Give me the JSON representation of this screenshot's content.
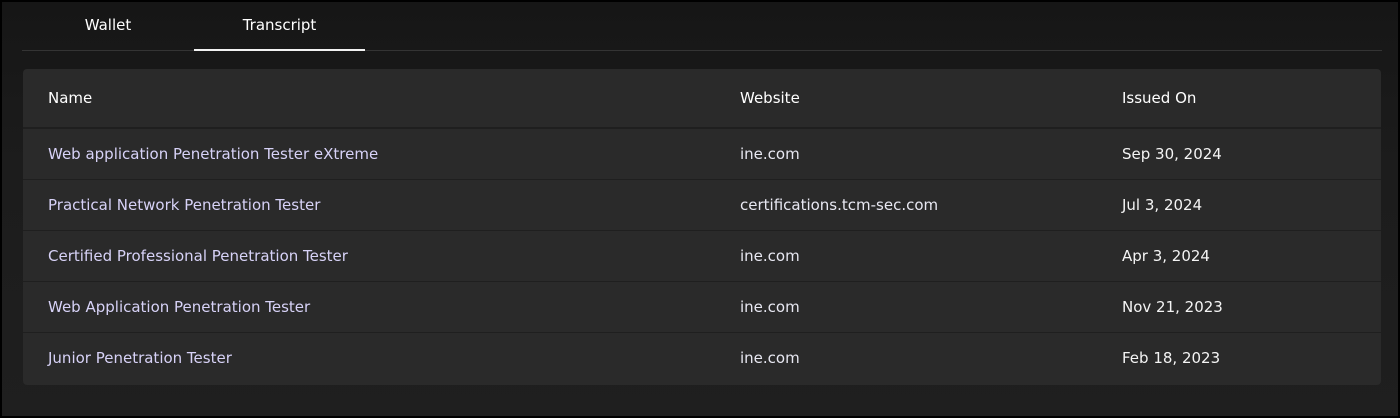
{
  "tabs": [
    {
      "label": "Wallet",
      "active": false
    },
    {
      "label": "Transcript",
      "active": true
    }
  ],
  "table": {
    "headers": [
      "Name",
      "Website",
      "Issued On"
    ],
    "rows": [
      {
        "name": "Web application Penetration Tester eXtreme",
        "website": "ine.com",
        "issued_on": "Sep 30, 2024"
      },
      {
        "name": "Practical Network Penetration Tester",
        "website": "certifications.tcm-sec.com",
        "issued_on": "Jul 3, 2024"
      },
      {
        "name": "Certified Professional Penetration Tester",
        "website": "ine.com",
        "issued_on": "Apr 3, 2024"
      },
      {
        "name": "Web Application Penetration Tester",
        "website": "ine.com",
        "issued_on": "Nov 21, 2023"
      },
      {
        "name": "Junior Penetration Tester",
        "website": "ine.com",
        "issued_on": "Feb 18, 2023"
      }
    ]
  },
  "colors": {
    "background": "#1c1c1c",
    "card": "#2a2a2a",
    "accent_underline": "#f2f2f2",
    "name_link": "#d7d2f7"
  }
}
